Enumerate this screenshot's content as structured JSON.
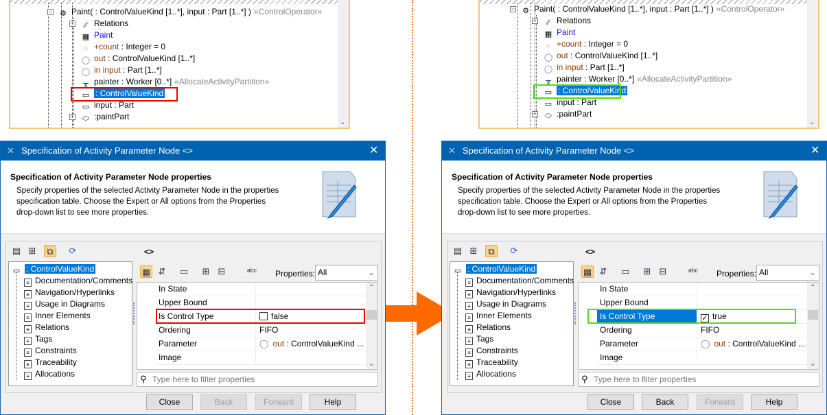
{
  "colors": {
    "accent": "#0078d7",
    "title_bar": "#0063b1",
    "highlight_before": "#e00000",
    "highlight_after": "#4cde1c",
    "arrow": "#ff6a00"
  },
  "panels": [
    {
      "state": "before",
      "model_tree": {
        "rows": [
          {
            "text": "Paint(  : ControlValueKind [1..*], input : Part [1..*] )",
            "suffix": "«ControlOperator»",
            "icon": "operation-icon"
          },
          {
            "text": "Relations",
            "icon": "relations-icon"
          },
          {
            "text": "Paint",
            "icon": "diagram-icon"
          },
          {
            "pre": "+count",
            "text": " : Integer = 0",
            "icon": "attribute-icon"
          },
          {
            "pre": "out",
            "text": "  : ControlValueKind [1..*]",
            "icon": "parameter-icon"
          },
          {
            "pre": "in input",
            "text": " : Part [1..*]",
            "icon": "parameter-icon"
          },
          {
            "text": "painter : Worker [0..*]",
            "suffix": "«AllocateActivityPartition»",
            "icon": "partition-icon"
          },
          {
            "text": ": ControlValueKind",
            "icon": "activity-parameter-node-warning-icon",
            "selected": true
          },
          {
            "text": "input : Part",
            "icon": "activity-parameter-node-icon"
          },
          {
            "text": ":paintPart",
            "icon": "action-icon"
          }
        ]
      },
      "dialog": {
        "title": "Specification of Activity Parameter Node <>",
        "header_title": "Specification of Activity Parameter Node properties",
        "header_lines": [
          "Specify properties of the selected Activity Parameter Node in the properties",
          "specification table. Choose the Expert or All options from the Properties",
          "drop-down list to see more properties."
        ],
        "element_name": "<>",
        "tree_root": ": ControlValueKind",
        "tree_items": [
          "Documentation/Comments",
          "Navigation/Hyperlinks",
          "Usage in Diagrams",
          "Inner Elements",
          "Relations",
          "Tags",
          "Constraints",
          "Traceability",
          "Allocations"
        ],
        "properties_label": "Properties:",
        "properties_value": "All",
        "rows": [
          {
            "name": "In State",
            "value": ""
          },
          {
            "name": "Upper Bound",
            "value": ""
          },
          {
            "name": "Is Control Type",
            "value": "false",
            "checkbox": false
          },
          {
            "name": "Ordering",
            "value": "FIFO"
          },
          {
            "name": "Parameter",
            "pre": "out",
            "value": "  : ControlValueKind ..."
          },
          {
            "name": "Image",
            "value": ""
          }
        ],
        "filter_placeholder": "Type here to filter properties",
        "buttons": {
          "close": "Close",
          "back": "Back",
          "forward": "Forward",
          "help": "Help"
        },
        "back_enabled": false
      }
    },
    {
      "state": "after",
      "model_tree": {
        "rows": [
          {
            "text": "Paint(  : ControlValueKind [1..*], input : Part [1..*] )",
            "suffix": "«ControlOperator»",
            "icon": "operation-icon"
          },
          {
            "text": "Relations",
            "icon": "relations-icon"
          },
          {
            "text": "Paint",
            "icon": "diagram-icon"
          },
          {
            "pre": "+count",
            "text": " : Integer = 0",
            "icon": "attribute-icon"
          },
          {
            "pre": "out",
            "text": "  : ControlValueKind [1..*]",
            "icon": "parameter-icon"
          },
          {
            "pre": "in input",
            "text": " : Part [1..*]",
            "icon": "parameter-icon"
          },
          {
            "text": "painter : Worker [0..*]",
            "suffix": "«AllocateActivityPartition»",
            "icon": "partition-icon"
          },
          {
            "text": ": ControlValueKind",
            "icon": "activity-parameter-node-icon",
            "selected": true
          },
          {
            "text": "input : Part",
            "icon": "activity-parameter-node-icon"
          },
          {
            "text": ":paintPart",
            "icon": "action-icon"
          }
        ]
      },
      "dialog": {
        "title": "Specification of Activity Parameter Node <>",
        "header_title": "Specification of Activity Parameter Node properties",
        "header_lines": [
          "Specify properties of the selected Activity Parameter Node in the properties",
          "specification table. Choose the Expert or All options from the Properties",
          "drop-down list to see more properties."
        ],
        "element_name": "<>",
        "tree_root": ": ControlValueKind",
        "tree_items": [
          "Documentation/Comments",
          "Navigation/Hyperlinks",
          "Usage in Diagrams",
          "Inner Elements",
          "Relations",
          "Tags",
          "Constraints",
          "Traceability",
          "Allocations"
        ],
        "properties_label": "Properties:",
        "properties_value": "All",
        "rows": [
          {
            "name": "In State",
            "value": ""
          },
          {
            "name": "Upper Bound",
            "value": ""
          },
          {
            "name": "Is Control Type",
            "value": "true",
            "checkbox": true,
            "selected": true
          },
          {
            "name": "Ordering",
            "value": "FIFO"
          },
          {
            "name": "Parameter",
            "pre": "out",
            "value": "  : ControlValueKind ..."
          },
          {
            "name": "Image",
            "value": ""
          }
        ],
        "filter_placeholder": "Type here to filter properties",
        "buttons": {
          "close": "Close",
          "back": "Back",
          "forward": "Forward",
          "help": "Help"
        },
        "back_enabled": true
      }
    }
  ]
}
